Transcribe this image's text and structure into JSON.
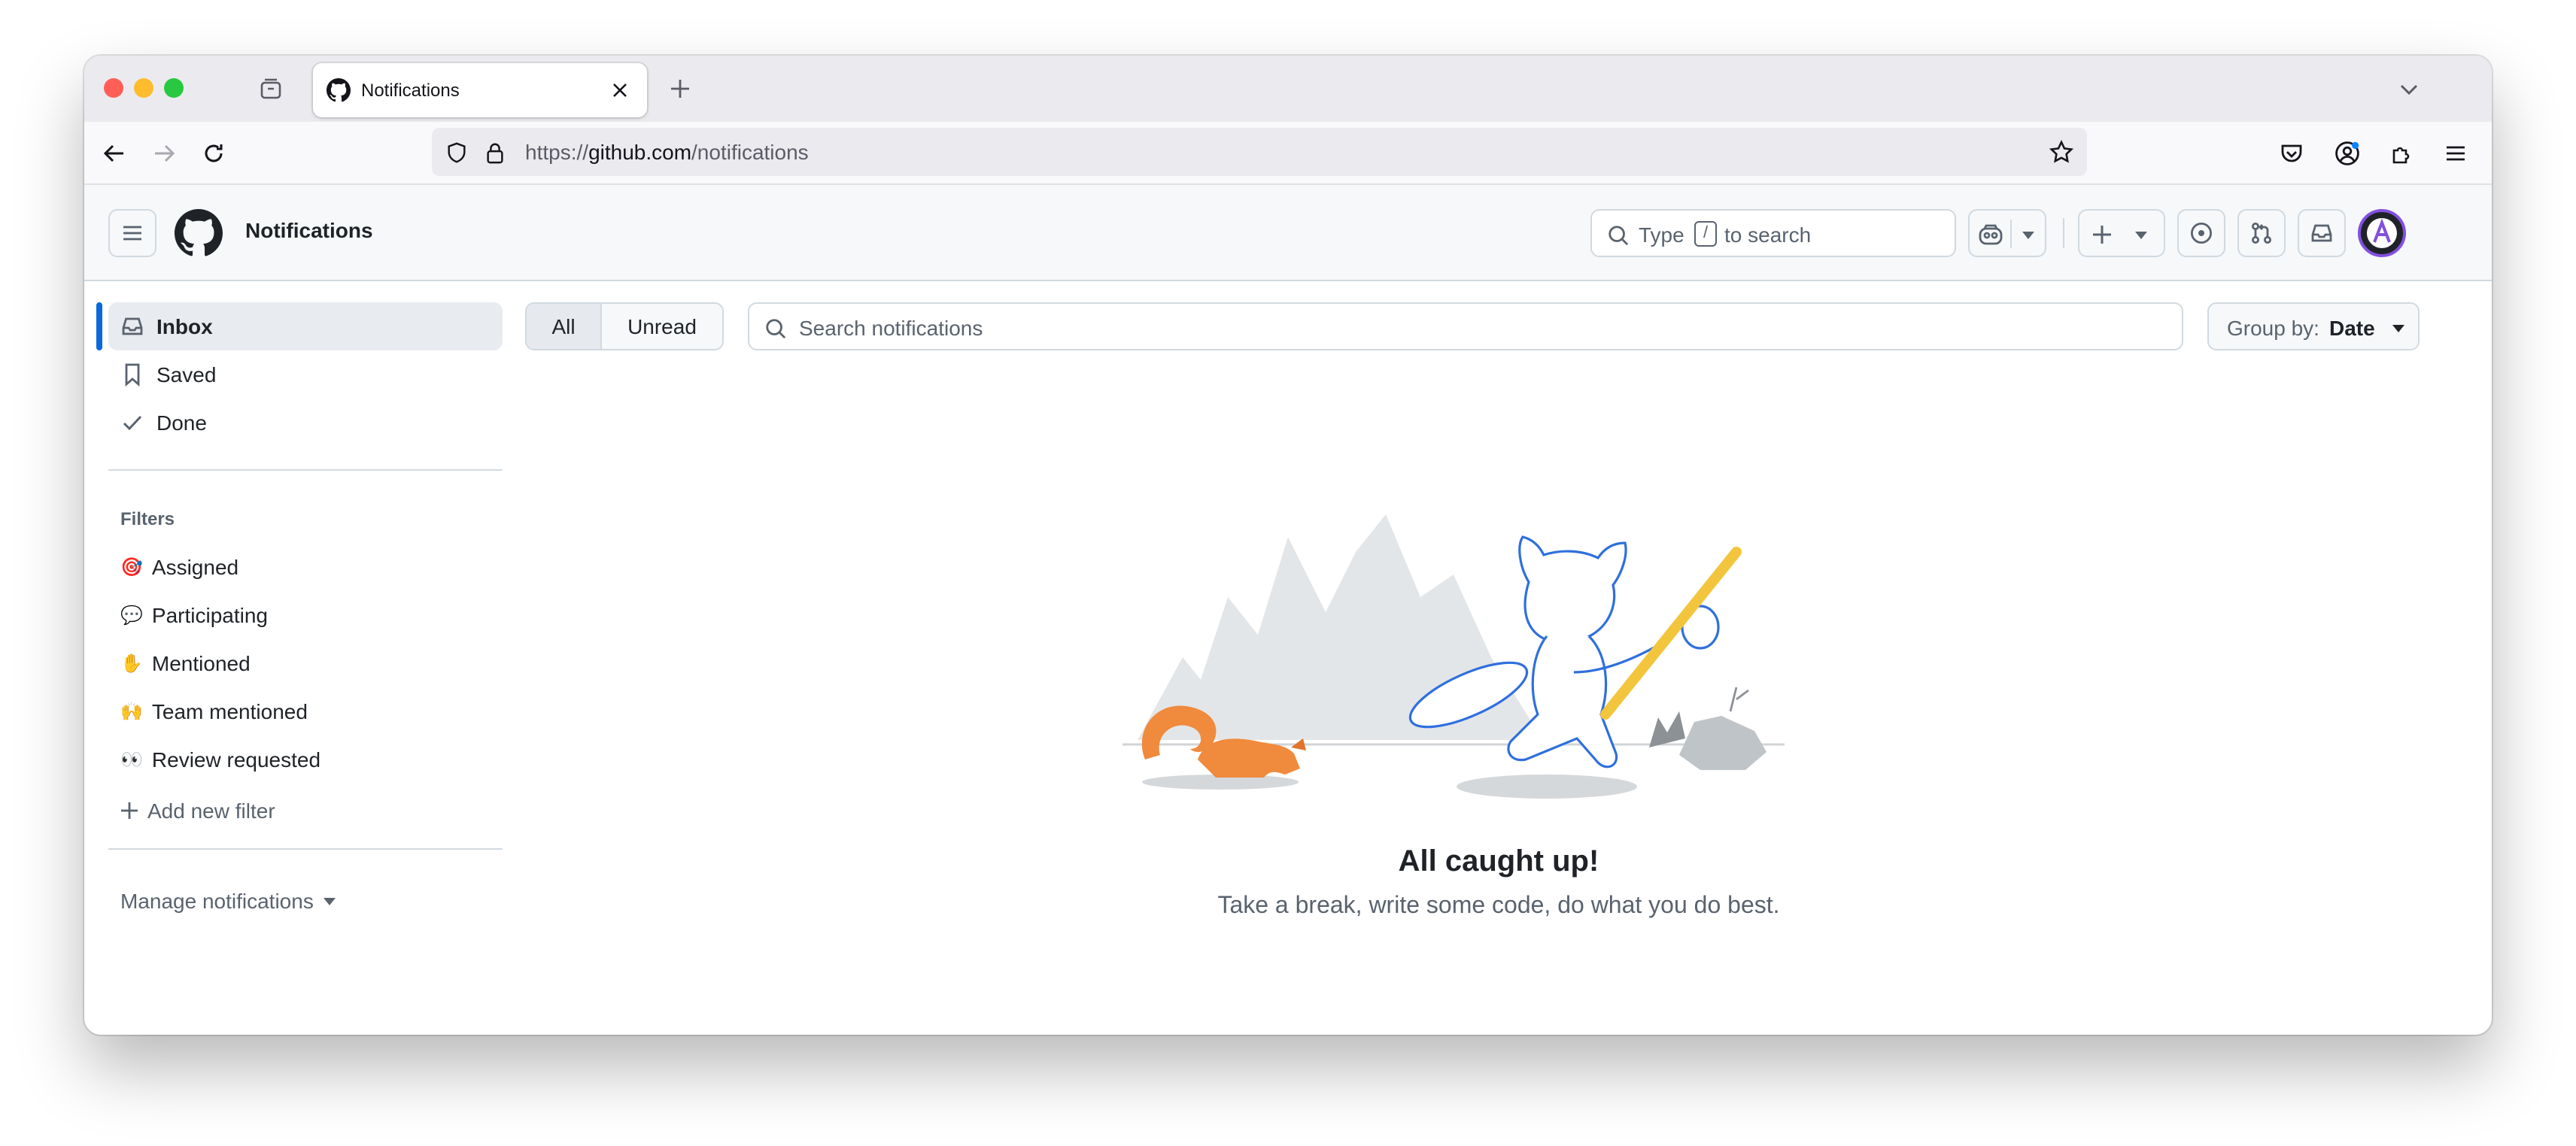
{
  "browser": {
    "tab_title": "Notifications",
    "url_prefix": "https://",
    "url_domain": "github.com",
    "url_path": "/notifications",
    "icons": [
      "close-icon",
      "new-tab-icon",
      "back-icon",
      "forward-icon",
      "reload-icon",
      "shield-icon",
      "lock-icon",
      "bookmark-star-icon",
      "pocket-icon",
      "account-icon",
      "extensions-icon",
      "menu-icon",
      "tab-list-chevron-icon",
      "tab-overview-icon"
    ]
  },
  "header": {
    "page_title": "Notifications",
    "search_prefix": "Type",
    "search_key": "/",
    "search_suffix": "to search"
  },
  "sidebar": {
    "items": [
      {
        "label": "Inbox",
        "icon": "inbox-icon",
        "active": true
      },
      {
        "label": "Saved",
        "icon": "bookmark-icon",
        "active": false
      },
      {
        "label": "Done",
        "icon": "check-icon",
        "active": false
      }
    ],
    "filters_heading": "Filters",
    "filters": [
      {
        "emoji": "🎯",
        "label": "Assigned"
      },
      {
        "emoji": "💬",
        "label": "Participating"
      },
      {
        "emoji": "✋",
        "label": "Mentioned"
      },
      {
        "emoji": "🙌",
        "label": "Team mentioned"
      },
      {
        "emoji": "👀",
        "label": "Review requested"
      }
    ],
    "add_filter_label": "Add new filter",
    "manage_label": "Manage notifications"
  },
  "toolbar": {
    "all_label": "All",
    "unread_label": "Unread",
    "search_placeholder": "Search notifications",
    "group_by_prefix": "Group by:",
    "group_by_value": "Date"
  },
  "empty_state": {
    "title": "All caught up!",
    "subtitle": "Take a break, write some code, do what you do best."
  },
  "colors": {
    "accent": "#0969da",
    "active_bar": "#0969da",
    "mascot_outline": "#2f6fde",
    "squirrel": "#f08a3c",
    "pole": "#f2c53d",
    "avatar_ring": "#8250df"
  }
}
